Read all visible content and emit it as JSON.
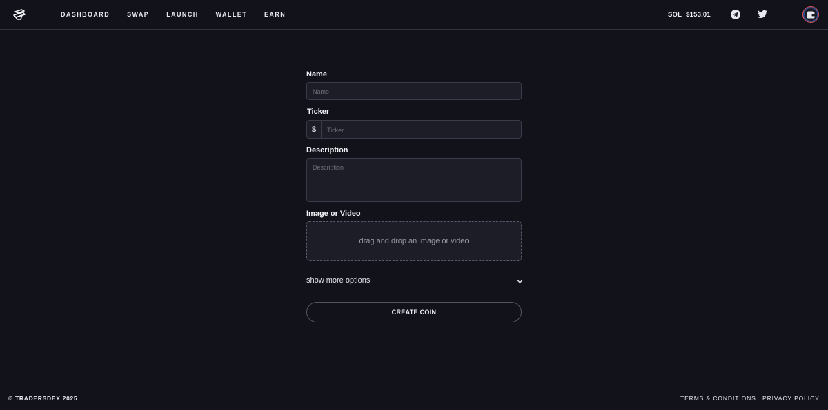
{
  "nav": {
    "items": [
      {
        "label": "DASHBOARD"
      },
      {
        "label": "SWAP"
      },
      {
        "label": "LAUNCH"
      },
      {
        "label": "WALLET"
      },
      {
        "label": "EARN"
      }
    ]
  },
  "header": {
    "sol_label": "SOL",
    "sol_price": "$153.01",
    "icons": [
      "logo-icon",
      "telegram-icon",
      "twitter-icon",
      "wallet-icon"
    ]
  },
  "form": {
    "name_label": "Name",
    "name_placeholder": "Name",
    "ticker_label": "Ticker",
    "ticker_prefix": "$",
    "ticker_placeholder": "Ticker",
    "description_label": "Description",
    "description_placeholder": "Description",
    "media_label": "Image or Video",
    "dropzone_text": "drag and drop an image or video",
    "more_options": "show more options",
    "create_button": "CREATE COIN"
  },
  "footer": {
    "copyright": "© TRADERSDEX 2025",
    "terms": "TERMS & CONDITIONS",
    "privacy": "PRIVACY POLICY"
  },
  "colors": {
    "background": "#12121b",
    "field_bg": "#1d1d28",
    "border": "#3a3a48",
    "wallet_ring": "#d9535c"
  }
}
